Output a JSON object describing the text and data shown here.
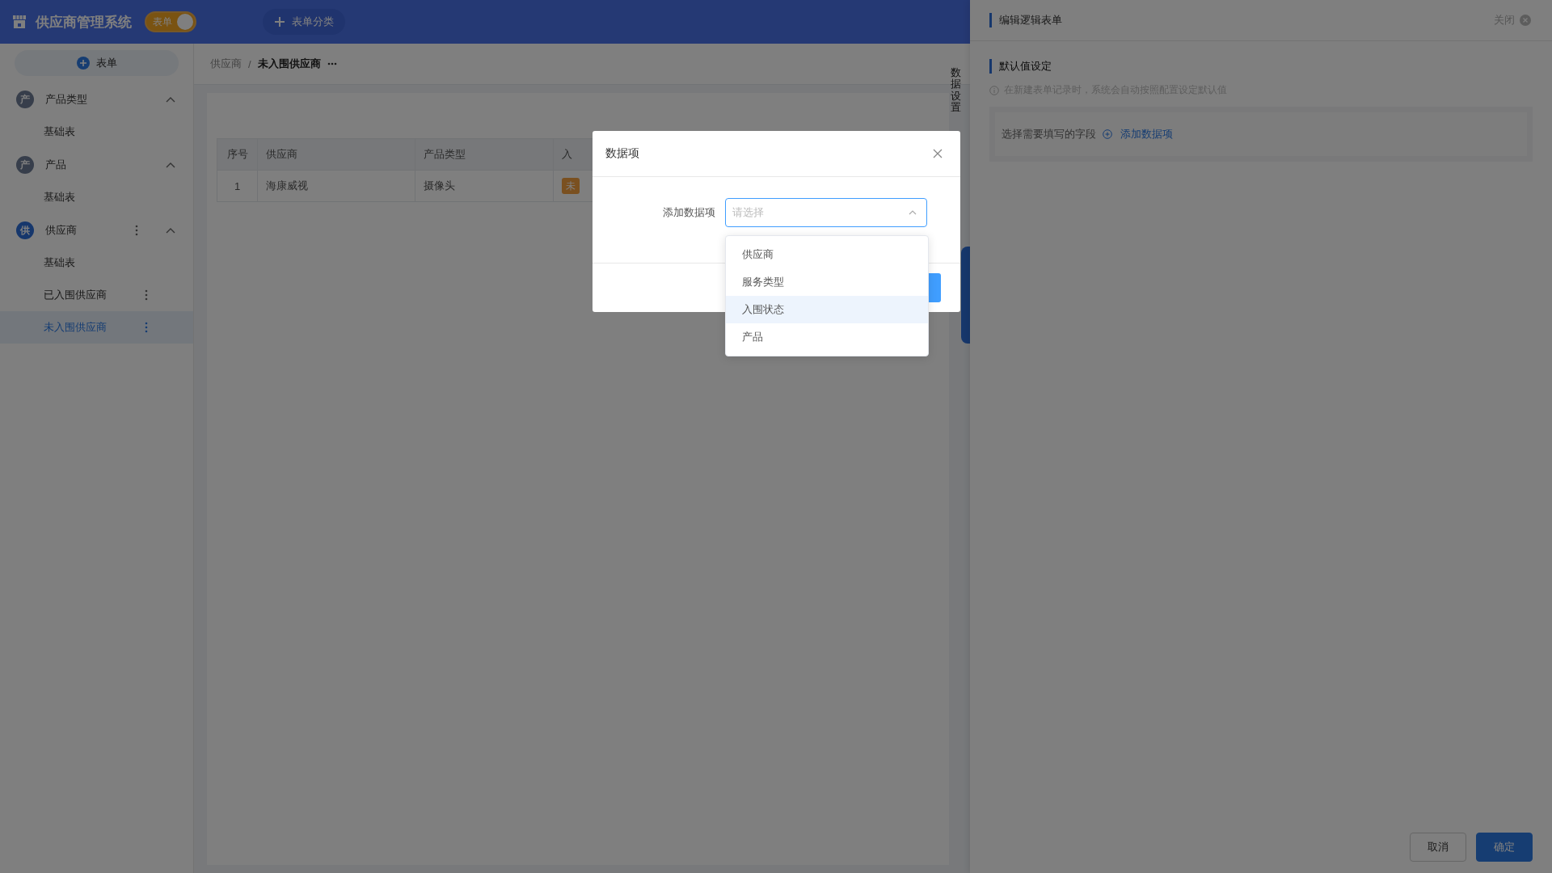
{
  "header": {
    "title": "供应商管理系统",
    "toggle": {
      "label": "表单",
      "on": true
    },
    "category_button": "表单分类"
  },
  "sidebar": {
    "add_button": "表单",
    "groups": [
      {
        "badge": "产",
        "label": "产品类型",
        "active": false,
        "has_menu": false,
        "expanded": true,
        "children": [
          {
            "label": "基础表",
            "selected": false,
            "has_menu": false
          }
        ]
      },
      {
        "badge": "产",
        "label": "产品",
        "active": false,
        "has_menu": false,
        "expanded": true,
        "children": [
          {
            "label": "基础表",
            "selected": false,
            "has_menu": false
          }
        ]
      },
      {
        "badge": "供",
        "label": "供应商",
        "active": true,
        "has_menu": true,
        "expanded": true,
        "children": [
          {
            "label": "基础表",
            "selected": false,
            "has_menu": false
          },
          {
            "label": "已入围供应商",
            "selected": false,
            "has_menu": true
          },
          {
            "label": "未入围供应商",
            "selected": true,
            "has_menu": true
          }
        ]
      }
    ]
  },
  "breadcrumb": {
    "items": [
      "供应商",
      "未入围供应商"
    ],
    "separator": "/"
  },
  "table": {
    "columns": [
      "序号",
      "供应商",
      "产品类型",
      "入"
    ],
    "rows": [
      {
        "cells": [
          "1",
          "海康威视",
          "摄像头"
        ],
        "tag": "未"
      }
    ]
  },
  "side_tab": "数据设置",
  "drawer": {
    "title": "编辑逻辑表单",
    "close": "关闭",
    "section": "默认值设定",
    "hint": "在新建表单记录时，系统会自动按照配置设定默认值",
    "field_prompt": "选择需要填写的字段",
    "add_link": "添加数据项",
    "buttons": [
      "取消",
      "确定"
    ]
  },
  "dialog": {
    "title": "数据项",
    "field_label": "添加数据项",
    "placeholder": "请选择",
    "open": true,
    "options": [
      {
        "label": "供应商",
        "selected": false
      },
      {
        "label": "服务类型",
        "selected": false
      },
      {
        "label": "入围状态",
        "selected": true
      },
      {
        "label": "产品",
        "selected": false
      }
    ]
  }
}
